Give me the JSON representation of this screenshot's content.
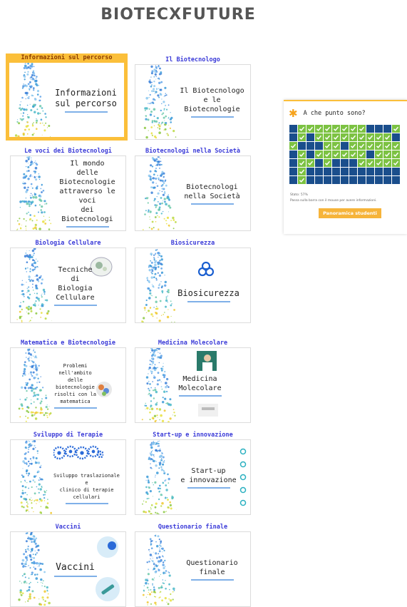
{
  "site": {
    "brand": "BIOTECXFUTURE"
  },
  "cards": [
    {
      "title": "Informazioni sul percorso",
      "thumb_text": "Informazioni\nsul percorso",
      "size": "l",
      "active": true,
      "icon": ""
    },
    {
      "title": "Il Biotecnologo",
      "thumb_text": "Il Biotecnologo\ne le\nBiotecnologie",
      "size": "m",
      "active": false,
      "icon": ""
    },
    {
      "title": "Le voci dei Biotecnologi",
      "thumb_text": "Il mondo\ndelle Biotecnologie\nattraverso le voci\ndei Biotecnologi",
      "size": "m",
      "active": false,
      "icon": ""
    },
    {
      "title": "Biotecnologi nella Società",
      "thumb_text": "Biotecnologi\nnella Società",
      "size": "m",
      "active": false,
      "icon": ""
    },
    {
      "title": "Biologia Cellulare",
      "thumb_text": "Tecniche di\nBiologia Cellulare",
      "size": "m",
      "active": false,
      "icon": "cell-image-icon"
    },
    {
      "title": "Biosicurezza",
      "thumb_text": "Biosicurezza",
      "size": "l",
      "active": false,
      "icon": "biohazard-icon"
    },
    {
      "title": "Matematica e Biotecnologie",
      "thumb_text": "Problemi nell'ambito\ndelle biotecnologie\nrisolti con la\nmatematica",
      "size": "s",
      "active": false,
      "icon": "brain-icon"
    },
    {
      "title": "Medicina Molecolare",
      "thumb_text": "Medicina\nMolecolare",
      "size": "m",
      "active": false,
      "icon": "doctor-icon"
    },
    {
      "title": "Sviluppo di Terapie",
      "thumb_text": "Sviluppo traslazionale e\nclinico di terapie cellulari",
      "size": "s",
      "active": false,
      "icon": "gears-icon"
    },
    {
      "title": "Start-up e innovazione",
      "thumb_text": "Start-up\ne innovazione",
      "size": "m",
      "active": false,
      "icon": "chain-icon"
    },
    {
      "title": "Vaccini",
      "thumb_text": "Vaccini",
      "size": "xl",
      "active": false,
      "icon": "virus-icon"
    },
    {
      "title": "Questionario finale",
      "thumb_text": "Questionario\nfinale",
      "size": "m",
      "active": false,
      "icon": ""
    }
  ],
  "progress_widget": {
    "title": "A che punto sono?",
    "status": "Stato: 57%",
    "hint": "Passa sulla barra con il mouse per avere informazioni.",
    "button_label": "Panoramica studenti",
    "grid_rows": [
      "0111111110001",
      "0101111111110",
      "1000110111111",
      "0101111110111",
      "0110100011111",
      "0100000000000",
      "0100000000000"
    ],
    "colors": {
      "done": "#7cc242",
      "todo": "#1a4e8c",
      "accent": "#fbbf3a"
    }
  }
}
